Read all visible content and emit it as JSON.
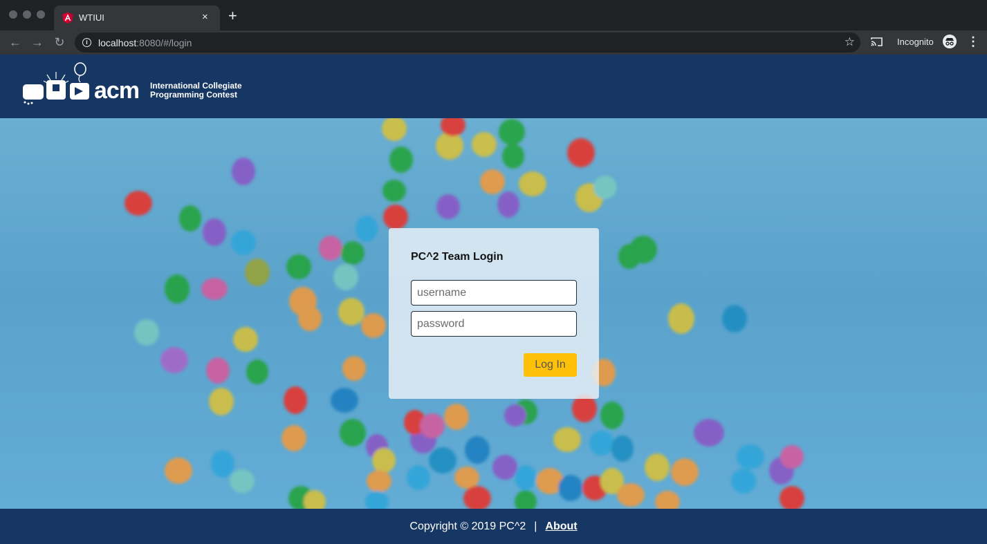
{
  "browser": {
    "tab_title": "WTIUI",
    "tab_close": "×",
    "new_tab": "+",
    "url_host": "localhost",
    "url_path": ":8080/#/login",
    "incognito_label": "Incognito",
    "menu": "⋮"
  },
  "header": {
    "logo_acm": "acm",
    "logo_line1": "International Collegiate",
    "logo_line2": "Programming Contest"
  },
  "login": {
    "title": "PC^2 Team Login",
    "username_placeholder": "username",
    "password_placeholder": "password",
    "button_label": "Log In"
  },
  "footer": {
    "copyright": "Copyright © 2019 PC^2",
    "separator": "|",
    "about_label": "About"
  },
  "colors": {
    "header_bg": "#163763",
    "button": "#ffc107"
  }
}
